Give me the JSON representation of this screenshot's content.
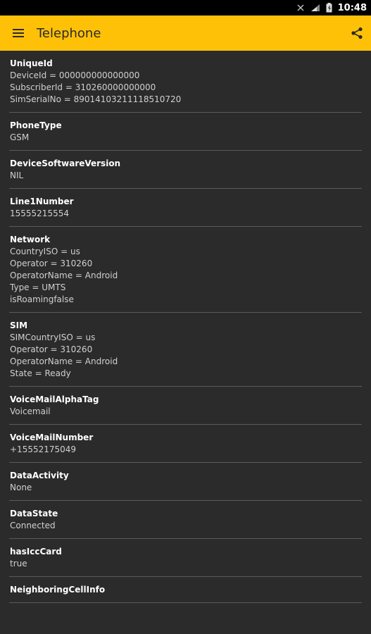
{
  "status_bar": {
    "time": "10:48"
  },
  "app_bar": {
    "title": "Telephone",
    "menu_icon": "menu-icon",
    "share_icon": "share-icon"
  },
  "colors": {
    "accent": "#ffc107",
    "background": "#2b2b2b",
    "divider": "#5a5a5a"
  },
  "sections": [
    {
      "title": "UniqueId",
      "lines": [
        "DeviceId = 000000000000000",
        "SubscriberId = 310260000000000",
        "SimSerialNo = 89014103211118510720"
      ]
    },
    {
      "title": "PhoneType",
      "lines": [
        "GSM"
      ]
    },
    {
      "title": "DeviceSoftwareVersion",
      "lines": [
        "NIL"
      ]
    },
    {
      "title": "Line1Number",
      "lines": [
        "15555215554"
      ]
    },
    {
      "title": "Network",
      "lines": [
        "CountryISO = us",
        "Operator = 310260",
        "OperatorName = Android",
        "Type = UMTS",
        "isRoamingfalse"
      ]
    },
    {
      "title": "SIM",
      "lines": [
        "SIMCountryISO = us",
        "Operator = 310260",
        "OperatorName = Android",
        "State = Ready"
      ]
    },
    {
      "title": "VoiceMailAlphaTag",
      "lines": [
        "Voicemail"
      ]
    },
    {
      "title": "VoiceMailNumber",
      "lines": [
        "+15552175049"
      ]
    },
    {
      "title": "DataActivity",
      "lines": [
        "None"
      ]
    },
    {
      "title": "DataState",
      "lines": [
        "Connected"
      ]
    },
    {
      "title": "hasIccCard",
      "lines": [
        "true"
      ]
    },
    {
      "title": "NeighboringCellInfo",
      "lines": []
    }
  ]
}
